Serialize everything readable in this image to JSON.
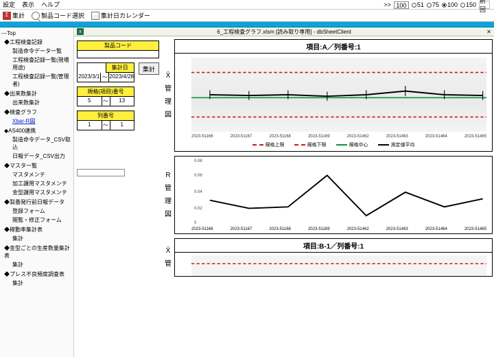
{
  "menubar": {
    "items": [
      "設定",
      "表示",
      "ヘルプ"
    ]
  },
  "zoom": {
    "box_before": "100",
    "options": [
      {
        "label": "51",
        "sel": false
      },
      {
        "label": "75",
        "sel": false
      },
      {
        "label": "100",
        "sel": true
      },
      {
        "label": "150",
        "sel": false
      }
    ],
    "restore_label": "前回"
  },
  "toolbar": {
    "aggregate": "集計",
    "select_code": "製品コード選択",
    "calendar": "集計日カレンダー"
  },
  "doc_header": {
    "filename": "6_工程検査グラフ.xlsm",
    "mode": "[読み取り専用]",
    "app": "dbSheetClient"
  },
  "sidebar": {
    "top": "---Top",
    "groups": [
      {
        "title": "◆工程検査記録",
        "items": [
          "製造命令データ一覧",
          "工程検査記録一覧(現場用途)",
          "工程検査記録一覧(管理者)"
        ]
      },
      {
        "title": "◆出来数集計",
        "items": [
          "出来数集計"
        ]
      },
      {
        "title": "◆検査グラフ",
        "items": [
          "Xbar-R図"
        ],
        "highlight": 0
      },
      {
        "title": "◆AS400連携",
        "items": [
          "製造命令データ_CSV取込",
          "日報データ_CSV出力"
        ]
      },
      {
        "title": "◆マスター覧",
        "items": [
          "マスタメンテ",
          "加工課用マスタメンテ",
          "金型課用マスタメンテ"
        ]
      },
      {
        "title": "◆製番発行前日報データ",
        "items": [
          "登録フォーム",
          "閲覧・修正フォーム"
        ]
      },
      {
        "title": "◆稼動率集計表",
        "items": [
          "集計"
        ]
      },
      {
        "title": "◆金型ごとの生産数量集計表",
        "items": [
          "集計"
        ]
      },
      {
        "title": "◆プレス不良頻度調査表",
        "items": [
          "集計"
        ]
      }
    ]
  },
  "filters": {
    "code_caption": "製品コード",
    "code_value": "",
    "date_caption": "集計日",
    "date_from": "2023/3/1",
    "date_to": "2023/4/28",
    "spec_caption": "規格(項目)番号",
    "spec_from": "5",
    "spec_to": "13",
    "col_caption": "列番号",
    "col_from": "1",
    "col_to": "1",
    "tilde": "〜",
    "button": "集計"
  },
  "chart_data": [
    {
      "type": "line",
      "title": "項目:A／列番号:1",
      "axis_label": "X̄ 管 理 図",
      "categories": [
        "2023-51166",
        "2023-51167",
        "2023-51168",
        "2023-51169",
        "2023-51462",
        "2023-51463",
        "2023-51464",
        "2023-51465"
      ],
      "series": [
        {
          "name": "測定値平均",
          "values": [
            0.5,
            0.49,
            0.5,
            0.48,
            0.5,
            0.55,
            0.5,
            0.49
          ]
        }
      ],
      "ref_upper": 0.8,
      "ref_lower": 0.2,
      "ref_center": 0.46,
      "ylim": [
        0,
        1
      ],
      "legend": [
        "規格上限",
        "規格下限",
        "規格中心",
        "測定値平均"
      ]
    },
    {
      "type": "line",
      "title": "",
      "axis_label": "R 管 理 図",
      "categories": [
        "2023-51166",
        "2023-51167",
        "2023-51168",
        "2023-51169",
        "2023-51462",
        "2023-51463",
        "2023-51464",
        "2023-51465"
      ],
      "series": [
        {
          "name": "R",
          "values": [
            0.03,
            0.02,
            0.022,
            0.06,
            0.012,
            0.04,
            0.022,
            0.032
          ]
        }
      ],
      "ylim": [
        0,
        0.08
      ]
    },
    {
      "type": "line",
      "title": "項目:B-1／列番号:1",
      "axis_label": "X̄ 管",
      "categories": [],
      "series": [],
      "ref_upper": 0.6,
      "ylim": [
        0,
        1
      ]
    }
  ]
}
